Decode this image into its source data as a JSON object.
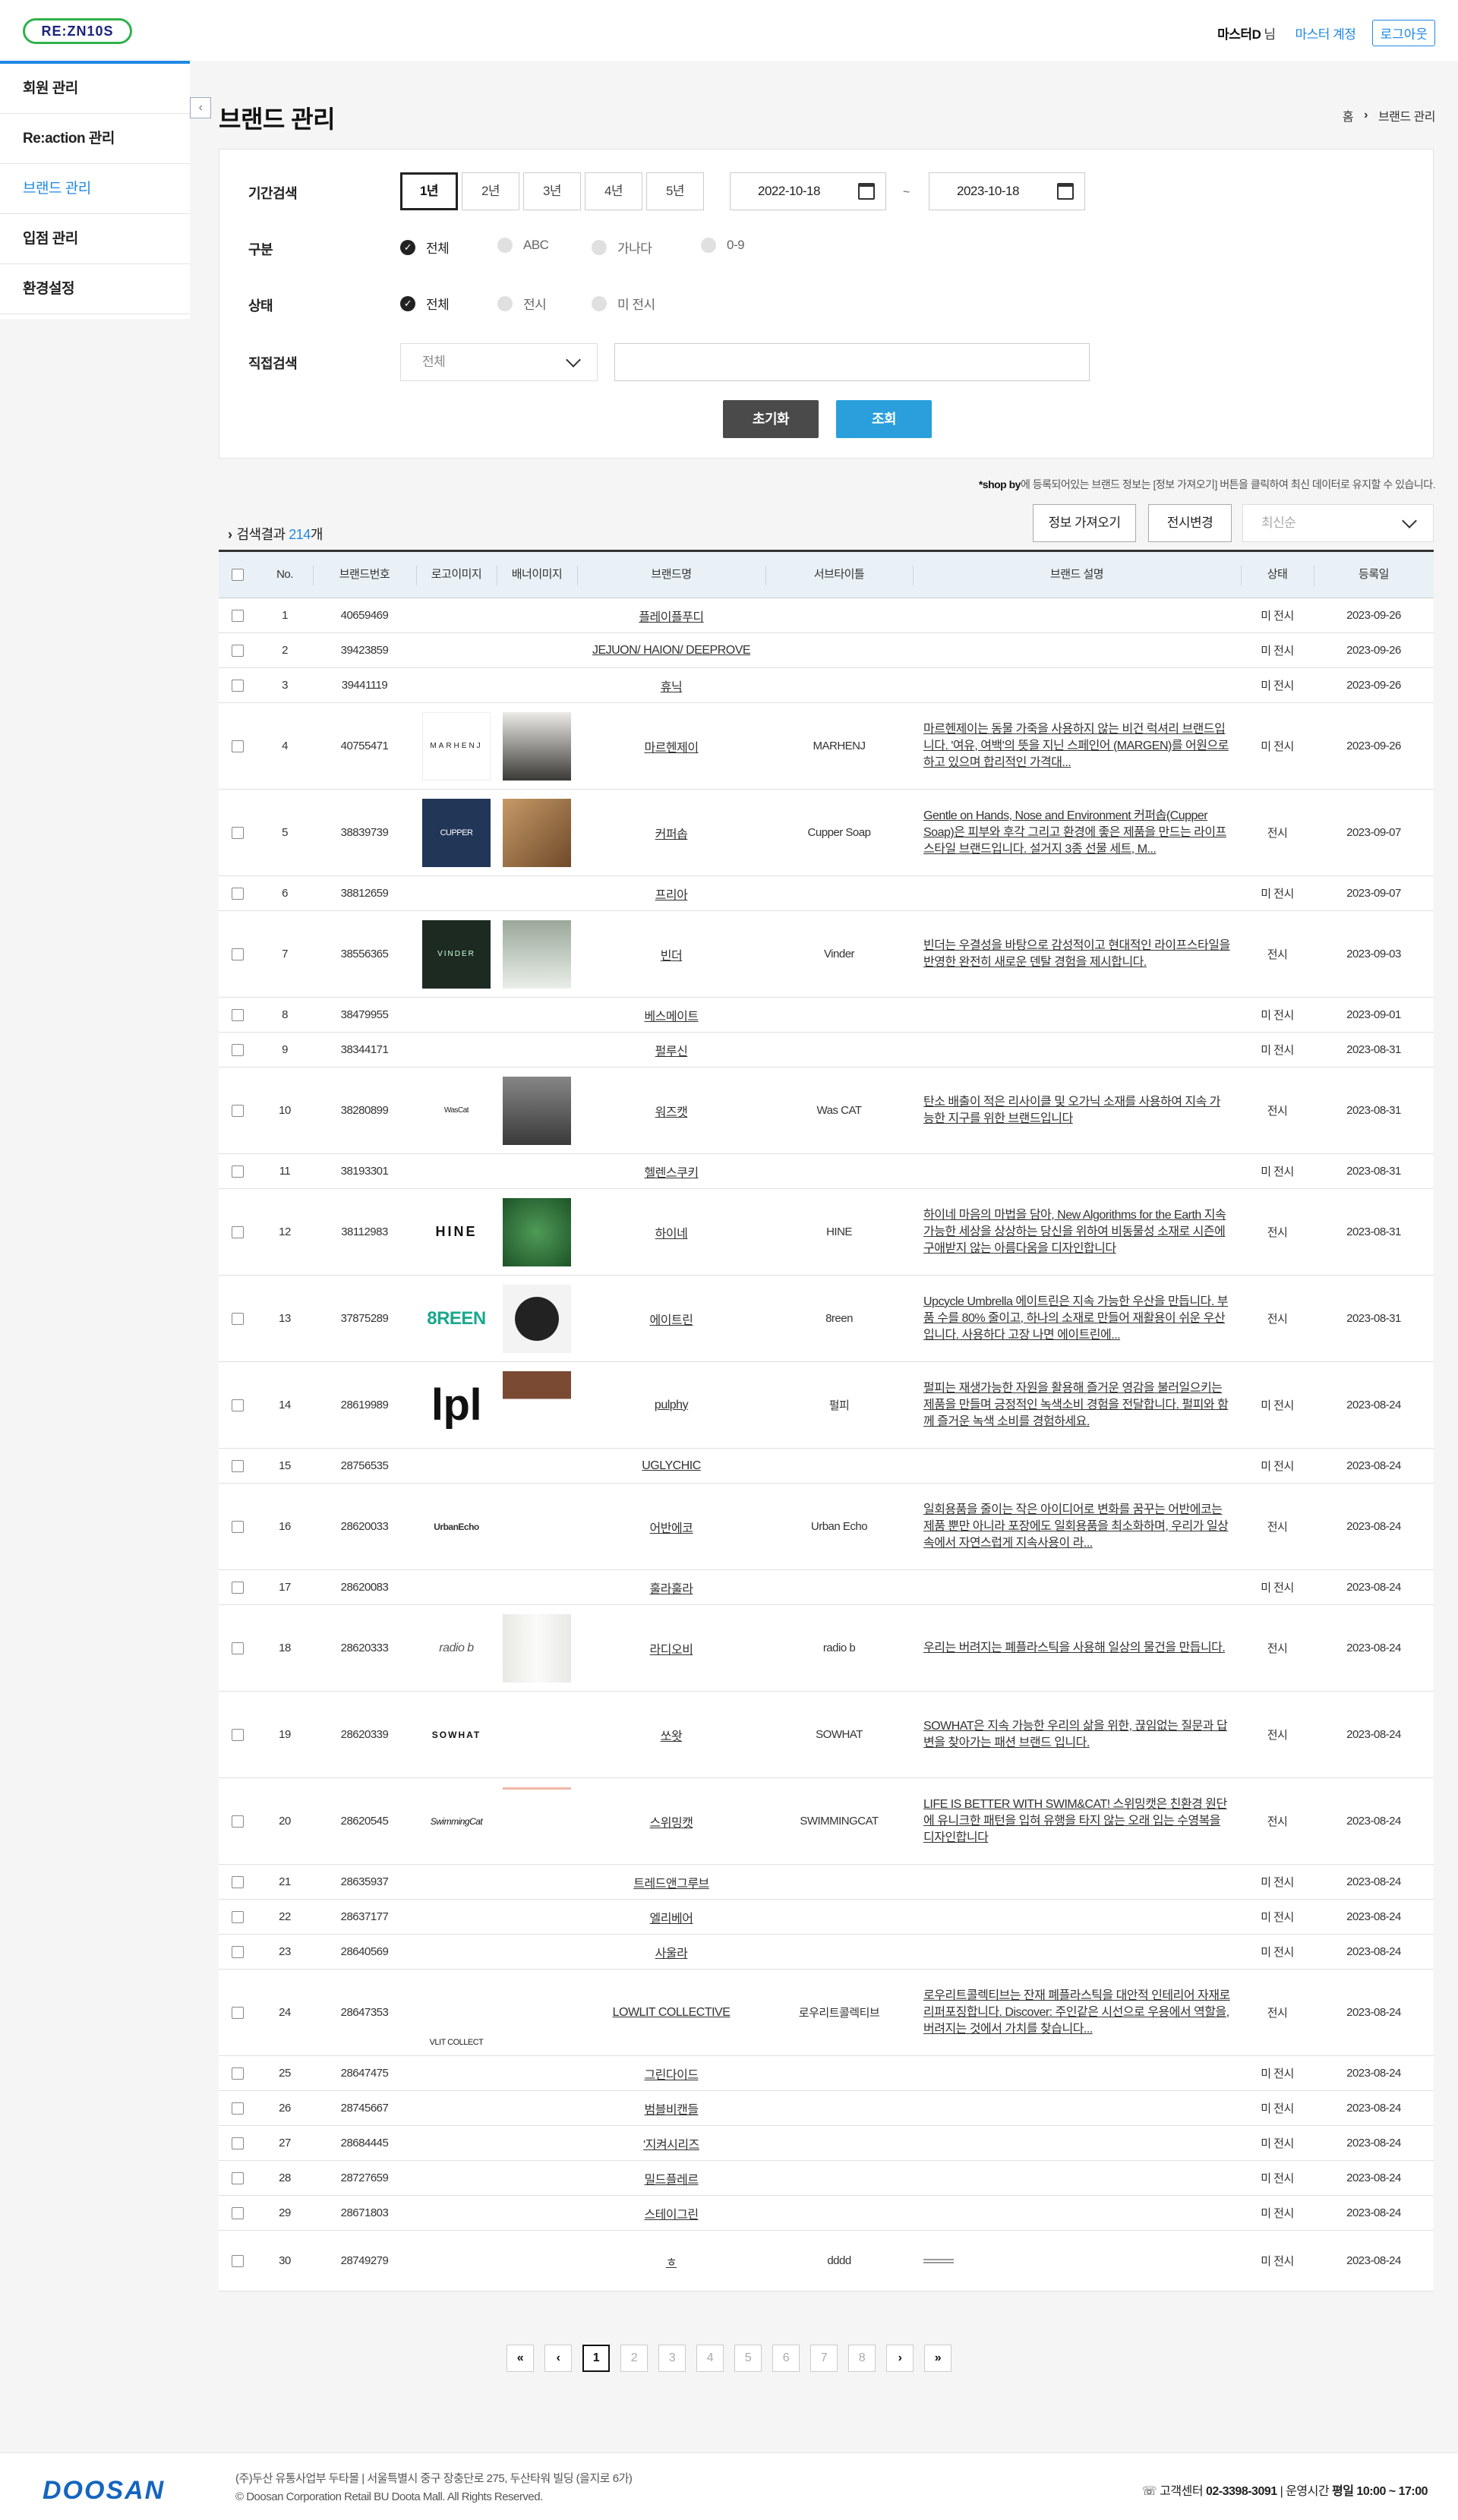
{
  "header": {
    "logo_text": "RE:ZN10S",
    "user_name": "마스터D",
    "user_suffix": "님",
    "master_account": "마스터 계정",
    "logout": "로그아웃"
  },
  "sidebar": {
    "items": [
      {
        "label": "회원 관리"
      },
      {
        "label": "Re:action 관리"
      },
      {
        "label": "브랜드 관리"
      },
      {
        "label": "입점 관리"
      },
      {
        "label": "환경설정"
      }
    ],
    "active_index": 2
  },
  "page": {
    "title": "브랜드 관리",
    "breadcrumb": [
      "홈",
      "브랜드 관리"
    ]
  },
  "filter": {
    "period_label": "기간검색",
    "periods": [
      "1년",
      "2년",
      "3년",
      "4년",
      "5년"
    ],
    "selected_period": "1년",
    "start_date": "2022-10-18",
    "end_date": "2023-10-18",
    "date_separator": "~",
    "category_label": "구분",
    "categories": [
      "전체",
      "ABC",
      "가나다",
      "0-9"
    ],
    "status_label": "상태",
    "statuses": [
      "전체",
      "전시",
      "미 전시"
    ],
    "direct_label": "직접검색",
    "direct_select": "전체",
    "direct_value": "",
    "reset": "초기화",
    "query": "조회"
  },
  "notice": {
    "shop": "*shop by",
    "text": "에 등록되어있는 브랜드 정보는 [정보 가져오기] 버튼을 클릭하여 최신 데이터로 유지할 수 있습니다."
  },
  "results": {
    "prefix": "검색결과",
    "count": "214",
    "suffix": "개",
    "fetch_button": "정보 가져오기",
    "display_button": "전시변경",
    "sort": "최신순"
  },
  "table": {
    "headers": [
      "No.",
      "브랜드번호",
      "로고이미지",
      "배너이미지",
      "브랜드명",
      "서브타이틀",
      "브랜드 설명",
      "상태",
      "등록일"
    ],
    "rows": [
      {
        "no": "1",
        "id": "40659469",
        "logo": "",
        "banner": "",
        "name": "플레이플푸디",
        "sub": "",
        "desc": "",
        "status": "미 전시",
        "date": "2023-09-26"
      },
      {
        "no": "2",
        "id": "39423859",
        "logo": "",
        "banner": "",
        "name": "JEJUON/ HAION/ DEEPROVE",
        "sub": "",
        "desc": "",
        "status": "미 전시",
        "date": "2023-09-26"
      },
      {
        "no": "3",
        "id": "39441119",
        "logo": "",
        "banner": "",
        "name": "휴닉",
        "sub": "",
        "desc": "",
        "status": "미 전시",
        "date": "2023-09-26"
      },
      {
        "no": "4",
        "id": "40755471",
        "logo": "MARHENJ",
        "banner": "person",
        "name": "마르헨제이",
        "sub": "MARHENJ",
        "desc": "마르헨제이는 동물 가죽을 사용하지 않는 비건 럭셔리 브랜드입니다. '여유, 여백'의 뜻을 지닌 스페인어 (MARGEN)를 어원으로 하고 있으며 합리적인 가격대...",
        "status": "미 전시",
        "date": "2023-09-26"
      },
      {
        "no": "5",
        "id": "38839739",
        "logo": "CUPPER",
        "banner": "box",
        "name": "커퍼솝",
        "sub": "Cupper Soap",
        "desc": "Gentle on Hands, Nose and Environment 커퍼솝(Cupper Soap)은 피부와 후각 그리고 환경에 좋은 제품을 만드는 라이프스타일 브랜드입니다. 설거지 3종 선물 세트, M...",
        "status": "전시",
        "date": "2023-09-07"
      },
      {
        "no": "6",
        "id": "38812659",
        "logo": "",
        "banner": "",
        "name": "프리아",
        "sub": "",
        "desc": "",
        "status": "미 전시",
        "date": "2023-09-07"
      },
      {
        "no": "7",
        "id": "38556365",
        "logo": "VINDER",
        "banner": "table",
        "name": "빈더",
        "sub": "Vinder",
        "desc": "빈더는 우결성을 바탕으로 감성적이고 현대적인 라이프스타일을 반영한 완전히 새로운 덴탈 경험을 제시합니다.",
        "status": "전시",
        "date": "2023-09-03"
      },
      {
        "no": "8",
        "id": "38479955",
        "logo": "",
        "banner": "",
        "name": "베스메이트",
        "sub": "",
        "desc": "",
        "status": "미 전시",
        "date": "2023-09-01"
      },
      {
        "no": "9",
        "id": "38344171",
        "logo": "",
        "banner": "",
        "name": "펄루신",
        "sub": "",
        "desc": "",
        "status": "미 전시",
        "date": "2023-08-31"
      },
      {
        "no": "10",
        "id": "38280899",
        "logo": "WasCat",
        "banner": "people",
        "name": "워즈캣",
        "sub": "Was CAT",
        "desc": "탄소 배출이 적은 리사이클 및 오가닉 소재를 사용하여 지속 가능한 지구를 위한 브랜드입니다",
        "status": "전시",
        "date": "2023-08-31"
      },
      {
        "no": "11",
        "id": "38193301",
        "logo": "",
        "banner": "",
        "name": "헬렌스쿠키",
        "sub": "",
        "desc": "",
        "status": "미 전시",
        "date": "2023-08-31"
      },
      {
        "no": "12",
        "id": "38112983",
        "logo": "HINE",
        "banner": "green",
        "name": "하이네",
        "sub": "HINE",
        "desc": "하이네 마음의 마법을 담아, New Algorithms for the Earth 지속가능한 세상을 상상하는 당신을 위하여 비동물성 소재로 시즌에 구애받지 않는 아름다움을 디자인합니다",
        "status": "전시",
        "date": "2023-08-31"
      },
      {
        "no": "13",
        "id": "37875289",
        "logo": "8REEN",
        "banner": "umbrella",
        "name": "에이트린",
        "sub": "8reen",
        "desc": "Upcycle Umbrella 에이트린은 지속 가능한 우산을 만듭니다. 부품 수를 80% 줄이고, 하나의 소재로 만들어 재활용이 쉬운 우산입니다. 사용하다 고장 나면 에이트린에...",
        "status": "전시",
        "date": "2023-08-31"
      },
      {
        "no": "14",
        "id": "28619989",
        "logo": "lpl",
        "banner": "brown",
        "name": "pulphy",
        "sub": "펄피",
        "desc": "펄피는 재생가능한 자원을 활용해 즐거운 영감을 불러일으키는 제품을 만들며 긍정적인 녹색소비 경험을 전달합니다. 펄피와 함께 즐거운 녹색 소비를 경험하세요.",
        "status": "미 전시",
        "date": "2023-08-24"
      },
      {
        "no": "15",
        "id": "28756535",
        "logo": "",
        "banner": "",
        "name": "UGLYCHIC",
        "sub": "",
        "desc": "",
        "status": "미 전시",
        "date": "2023-08-24"
      },
      {
        "no": "16",
        "id": "28620033",
        "logo": "UrbanEcho",
        "banner": "stripes",
        "name": "어반에코",
        "sub": "Urban Echo",
        "desc": "일회용품을 줄이는 작은 아이디어로 변화를 꿈꾸는 어반에코는 제품 뿐만 아니라 포장에도 일회용품을 최소화하며, 우리가 일상 속에서 자연스럽게 지속사용이 라...",
        "status": "전시",
        "date": "2023-08-24"
      },
      {
        "no": "17",
        "id": "28620083",
        "logo": "",
        "banner": "",
        "name": "훌라훌라",
        "sub": "",
        "desc": "",
        "status": "미 전시",
        "date": "2023-08-24"
      },
      {
        "no": "18",
        "id": "28620333",
        "logo": "radio b",
        "banner": "cylinder",
        "name": "라디오비",
        "sub": "radio b",
        "desc": "우리는 버려지는 폐플라스틱을 사용해 일상의 물건을 만듭니다.",
        "status": "전시",
        "date": "2023-08-24"
      },
      {
        "no": "19",
        "id": "28620339",
        "logo": "SOWHAT",
        "banner": "",
        "name": "쏘왓",
        "sub": "SOWHAT",
        "desc": "SOWHAT은 지속 가능한 우리의 삶을 위한, 끊임없는 질문과 답변을 찾아가는 패션 브랜드 입니다.",
        "status": "전시",
        "date": "2023-08-24"
      },
      {
        "no": "20",
        "id": "28620545",
        "logo": "SwimmingCat",
        "banner": "line",
        "name": "스위밍캣",
        "sub": "SWIMMINGCAT",
        "desc": "LIFE IS BETTER WITH SWIM&CAT! 스위밍캣은 친환경 원단에 유니크한 패턴을 입혀 유행을 타지 않는 오래 입는 수영복을 디자인합니다",
        "status": "전시",
        "date": "2023-08-24"
      },
      {
        "no": "21",
        "id": "28635937",
        "logo": "",
        "banner": "",
        "name": "트레드앤그루브",
        "sub": "",
        "desc": "",
        "status": "미 전시",
        "date": "2023-08-24"
      },
      {
        "no": "22",
        "id": "28637177",
        "logo": "",
        "banner": "",
        "name": "엘리베어",
        "sub": "",
        "desc": "",
        "status": "미 전시",
        "date": "2023-08-24"
      },
      {
        "no": "23",
        "id": "28640569",
        "logo": "",
        "banner": "",
        "name": "사울라",
        "sub": "",
        "desc": "",
        "status": "미 전시",
        "date": "2023-08-24"
      },
      {
        "no": "24",
        "id": "28647353",
        "logo": "VLIT COLLECT",
        "banner": "",
        "name": "LOWLIT COLLECTIVE",
        "sub": "로우리트콜렉티브",
        "desc": "로우리트콜렉티브는 잔재 폐플라스틱을 대안적 인테리어 자재로 리퍼포징합니다. Discover: 주인같은 시선으로 우용에서 역할을, 버려지는 것에서 가치를 찾습니다...",
        "status": "전시",
        "date": "2023-08-24"
      },
      {
        "no": "25",
        "id": "28647475",
        "logo": "",
        "banner": "",
        "name": "그린다이드",
        "sub": "",
        "desc": "",
        "status": "미 전시",
        "date": "2023-08-24"
      },
      {
        "no": "26",
        "id": "28745667",
        "logo": "",
        "banner": "",
        "name": "범블비캔들",
        "sub": "",
        "desc": "",
        "status": "미 전시",
        "date": "2023-08-24"
      },
      {
        "no": "27",
        "id": "28684445",
        "logo": "",
        "banner": "",
        "name": "'지켜시리즈",
        "sub": "",
        "desc": "",
        "status": "미 전시",
        "date": "2023-08-24"
      },
      {
        "no": "28",
        "id": "28727659",
        "logo": "",
        "banner": "",
        "name": "밀드플레르",
        "sub": "",
        "desc": "",
        "status": "미 전시",
        "date": "2023-08-24"
      },
      {
        "no": "29",
        "id": "28671803",
        "logo": "",
        "banner": "",
        "name": "스테이그린",
        "sub": "",
        "desc": "",
        "status": "미 전시",
        "date": "2023-08-24"
      },
      {
        "no": "30",
        "id": "28749279",
        "logo": "",
        "banner": "",
        "name": "ㅎ",
        "sub": "dddd",
        "desc": "",
        "status": "미 전시",
        "date": "2023-08-24"
      }
    ]
  },
  "pagination": {
    "first": "«",
    "prev": "‹",
    "pages": [
      "1",
      "2",
      "3",
      "4",
      "5",
      "6",
      "7",
      "8"
    ],
    "current": "1",
    "next": "›",
    "last": "»"
  },
  "footer": {
    "logo": "DOOSAN",
    "address": "(주)두산 유통사업부 두타몰 | 서울특별시 중구 장충단로 275, 두산타워 빌딩 (을지로 6가)",
    "copyright": "© Doosan Corporation Retail BU Doota Mall. All Rights Reserved.",
    "cs_label": "고객센터",
    "cs_phone": "02-3398-3091",
    "hours_label": "운영시간",
    "hours": "평일 10:00 ~ 17:00"
  },
  "colors": {
    "accent": "#1e88e5",
    "brand_green": "#2fb24a",
    "query_button": "#2a9fdc",
    "reset_button": "#4a4a4a"
  }
}
